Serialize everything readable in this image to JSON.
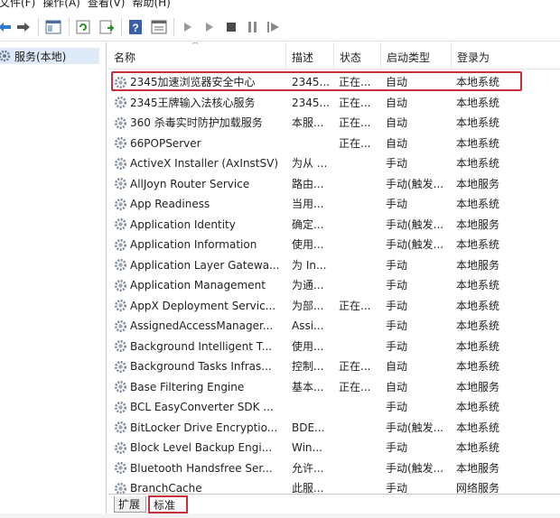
{
  "menu": {
    "items": [
      "文件(F)",
      "操作(A)",
      "查看(V)",
      "帮助(H)"
    ]
  },
  "toolbar": {
    "buttons": [
      "back-arrow-icon",
      "forward-arrow-icon",
      "console-tree-icon",
      "refresh-icon",
      "export-list-icon",
      "help-icon",
      "properties-icon",
      "start-icon",
      "start-alt-icon",
      "stop-icon",
      "pause-icon",
      "restart-icon"
    ]
  },
  "tree": {
    "root_label": "服务(本地)"
  },
  "columns": {
    "name": "名称",
    "desc": "描述",
    "status": "状态",
    "startup": "启动类型",
    "logon": "登录为",
    "sort_indicator": "^"
  },
  "services": [
    {
      "name": "2345加速浏览器安全中心",
      "desc": "2345...",
      "status": "正在...",
      "startup": "自动",
      "logon": "本地系统"
    },
    {
      "name": "2345王牌输入法核心服务",
      "desc": "2345...",
      "status": "正在...",
      "startup": "自动",
      "logon": "本地系统"
    },
    {
      "name": "360 杀毒实时防护加载服务",
      "desc": "本服...",
      "status": "正在...",
      "startup": "自动",
      "logon": "本地系统"
    },
    {
      "name": "66POPServer",
      "desc": "",
      "status": "正在...",
      "startup": "自动",
      "logon": "本地系统"
    },
    {
      "name": "ActiveX Installer (AxInstSV)",
      "desc": "为从 ...",
      "status": "",
      "startup": "手动",
      "logon": "本地系统"
    },
    {
      "name": "AllJoyn Router Service",
      "desc": "路由...",
      "status": "",
      "startup": "手动(触发...",
      "logon": "本地服务"
    },
    {
      "name": "App Readiness",
      "desc": "当用...",
      "status": "",
      "startup": "手动",
      "logon": "本地系统"
    },
    {
      "name": "Application Identity",
      "desc": "确定...",
      "status": "",
      "startup": "手动(触发...",
      "logon": "本地服务"
    },
    {
      "name": "Application Information",
      "desc": "使用...",
      "status": "",
      "startup": "手动(触发...",
      "logon": "本地系统"
    },
    {
      "name": "Application Layer Gatewa...",
      "desc": "为 In...",
      "status": "",
      "startup": "手动",
      "logon": "本地服务"
    },
    {
      "name": "Application Management",
      "desc": "为通...",
      "status": "",
      "startup": "手动",
      "logon": "本地系统"
    },
    {
      "name": "AppX Deployment Servic...",
      "desc": "为部...",
      "status": "正在...",
      "startup": "手动",
      "logon": "本地系统"
    },
    {
      "name": "AssignedAccessManager...",
      "desc": "Assi...",
      "status": "",
      "startup": "手动",
      "logon": "本地系统"
    },
    {
      "name": "Background Intelligent T...",
      "desc": "使用...",
      "status": "",
      "startup": "手动",
      "logon": "本地系统"
    },
    {
      "name": "Background Tasks Infras...",
      "desc": "控制...",
      "status": "正在...",
      "startup": "自动",
      "logon": "本地系统"
    },
    {
      "name": "Base Filtering Engine",
      "desc": "基本...",
      "status": "正在...",
      "startup": "自动",
      "logon": "本地服务"
    },
    {
      "name": "BCL EasyConverter SDK ...",
      "desc": "",
      "status": "",
      "startup": "手动",
      "logon": "本地系统"
    },
    {
      "name": "BitLocker Drive Encryptio...",
      "desc": "BDE...",
      "status": "",
      "startup": "手动(触发...",
      "logon": "本地系统"
    },
    {
      "name": "Block Level Backup Engi...",
      "desc": "Win...",
      "status": "",
      "startup": "手动",
      "logon": "本地系统"
    },
    {
      "name": "Bluetooth Handsfree Ser...",
      "desc": "允许...",
      "status": "",
      "startup": "手动(触发...",
      "logon": "本地服务"
    },
    {
      "name": "BranchCache",
      "desc": "此服...",
      "status": "",
      "startup": "手动",
      "logon": "网络服务"
    }
  ],
  "tabs": {
    "extended": "扩展",
    "standard": "标准"
  },
  "colors": {
    "highlight_box": "#c8303c",
    "tree_selection": "#dfeaf7"
  }
}
